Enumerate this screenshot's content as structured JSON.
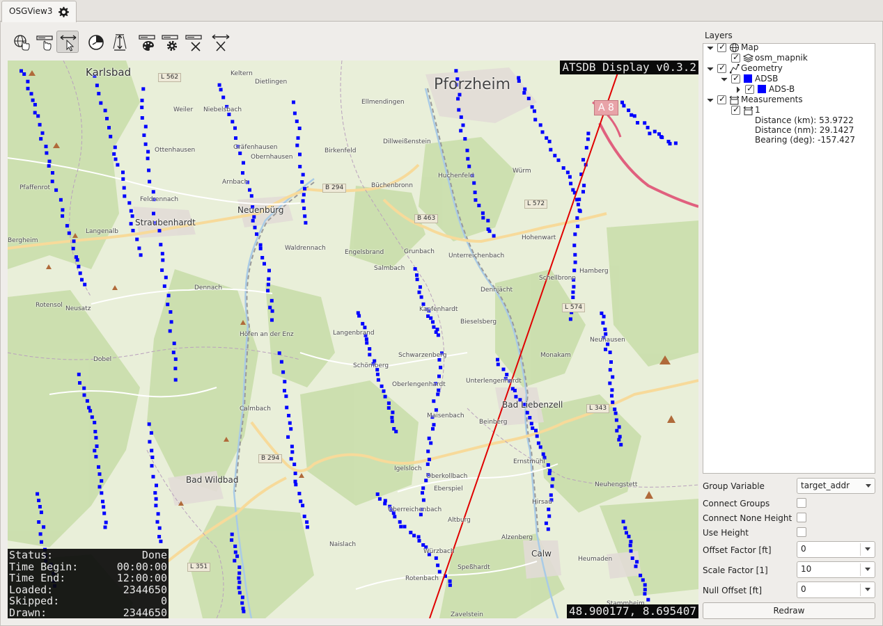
{
  "tab": {
    "label": "OSGView3"
  },
  "toolbar": {
    "tools": [
      "globe-navigate-icon",
      "label-pointer-icon",
      "measure-select-icon",
      "clock-icon",
      "height-measure-icon",
      "label-color-icon",
      "label-settings-icon",
      "label-clear-icon",
      "clear-measure-icon"
    ],
    "active_tool": "measure-select-icon"
  },
  "map": {
    "title": "ATSDB Display v0.3.2",
    "coordinates": "48.900177, 8.695407",
    "city": "Pforzheim",
    "towns": [
      "Karlsbad",
      "Keltern",
      "Neuenbürg",
      "Straubenhardt",
      "Bad Wildbad",
      "Bad Liebenzell",
      "Calw"
    ],
    "villages": [
      "Weiler",
      "Niebelsbach",
      "Dietlingen",
      "Ellmendingen",
      "Arnbach",
      "Ottenhausen",
      "Gräfenhausen",
      "Obernhausen",
      "Birkenfeld",
      "Dillweißenstein",
      "Huchenfeld",
      "Würm",
      "Büchenbronn",
      "Feldrennach",
      "Pfaffenrot",
      "Langenalb",
      "Engelsbrand",
      "Grunbach",
      "Salmbach",
      "Waldrennach",
      "Unterreichenbach",
      "Hohenwart",
      "Schellbronn",
      "Hamberg",
      "Dennach",
      "Rotensol",
      "Neusatz",
      "Kapfenhardt",
      "Dennjächt",
      "Langenbrand",
      "Bieselsberg",
      "Höfen an der Enz",
      "Schwarzenberg",
      "Neuhausen",
      "Dobel",
      "Schömberg",
      "Oberlengenhardt",
      "Unterlengenhardt",
      "Monakam",
      "Maisenbach",
      "Beinberg",
      "Calmbach",
      "Igelsloch",
      "Oberkollbach",
      "Ernstmühl",
      "Neuhengstett",
      "Eberspiel",
      "Oberreichenbach",
      "Hirsau",
      "Naislach",
      "Würzbach",
      "Altburg",
      "Alzenberg",
      "Heumaden",
      "Rotenbach",
      "Speßhardt",
      "Zavelstein",
      "Stammheim",
      "Bergheim"
    ],
    "roads": [
      "L 562",
      "B 294",
      "B 463",
      "L 572",
      "L 574",
      "L 343",
      "B 294",
      "L 351"
    ],
    "motorway": "A 8",
    "status": [
      {
        "label": "Status:",
        "value": "Done"
      },
      {
        "label": "Time Begin:",
        "value": "00:00:00"
      },
      {
        "label": "Time End:",
        "value": "12:00:00"
      },
      {
        "label": "Loaded:",
        "value": "2344650"
      },
      {
        "label": "Skipped:",
        "value": "0"
      },
      {
        "label": "Drawn:",
        "value": "2344650"
      }
    ],
    "track_color": "#0000ff",
    "measure_line_color": "#e00000"
  },
  "layers": {
    "title": "Layers",
    "map": "Map",
    "osm": "osm_mapnik",
    "geometry": "Geometry",
    "adsb": "ADSB",
    "adsb_b": "ADS-B",
    "measurements": "Measurements",
    "measure_1": "1",
    "distance_km": "Distance (km): 53.9722",
    "distance_nm": "Distance (nm): 29.1427",
    "bearing": "Bearing (deg): -157.427"
  },
  "form": {
    "group_variable_label": "Group Variable",
    "group_variable_value": "target_addr",
    "connect_groups_label": "Connect Groups",
    "connect_none_height_label": "Connect None Height",
    "use_height_label": "Use Height",
    "offset_factor_label": "Offset Factor [ft]",
    "offset_factor_value": "0",
    "scale_factor_label": "Scale Factor [1]",
    "scale_factor_value": "10",
    "null_offset_label": "Null Offset [ft]",
    "null_offset_value": "0",
    "redraw_label": "Redraw"
  }
}
